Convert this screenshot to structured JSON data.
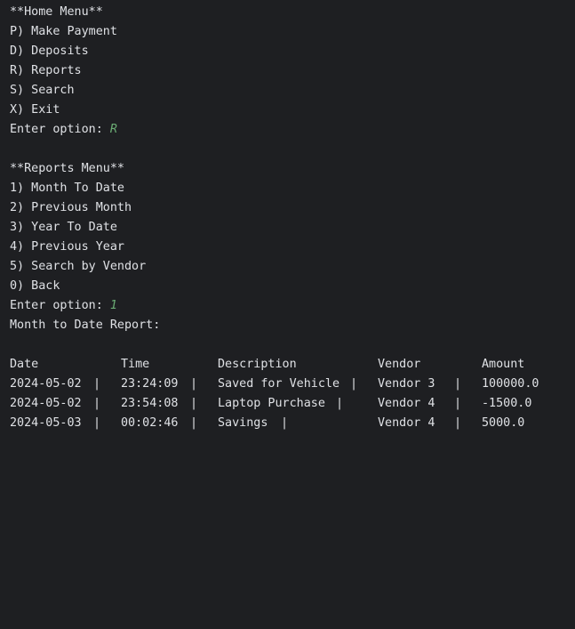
{
  "home_menu": {
    "title": "**Home Menu**",
    "items": [
      "P) Make Payment",
      "D) Deposits",
      "R) Reports",
      "S) Search",
      "X) Exit"
    ],
    "prompt": "Enter option: ",
    "input": "R"
  },
  "reports_menu": {
    "title": "**Reports Menu**",
    "items": [
      "1) Month To Date",
      "2) Previous Month",
      "3) Year To Date",
      "4) Previous Year",
      "5) Search by Vendor",
      "0) Back"
    ],
    "prompt": "Enter option: ",
    "input": "1"
  },
  "report": {
    "title": "Month to Date Report:",
    "headers": [
      "Date",
      "Time",
      "Description",
      "Vendor",
      "Amount"
    ],
    "rows": [
      {
        "date": "2024-05-02",
        "time": "23:24:09",
        "description": "Saved for Vehicle",
        "vendor": "Vendor 3",
        "amount": "100000.0"
      },
      {
        "date": "2024-05-02",
        "time": "23:54:08",
        "description": "Laptop Purchase",
        "vendor": "Vendor 4",
        "amount": "-1500.0"
      },
      {
        "date": "2024-05-03",
        "time": "00:02:46",
        "description": "Savings",
        "vendor": "Vendor 4",
        "amount": "5000.0"
      }
    ],
    "separator": "|"
  },
  "colors": {
    "background": "#1e1f22",
    "text": "#dfe1e5",
    "user_input": "#6aab73"
  }
}
